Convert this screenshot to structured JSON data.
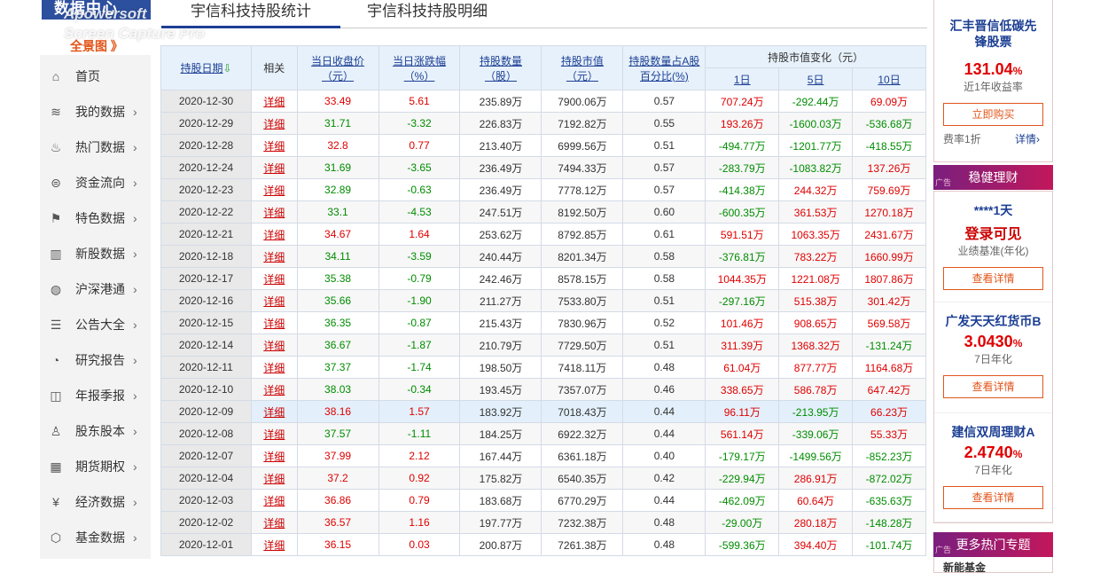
{
  "sidebar": {
    "brand_title": "数据中心",
    "brand_all": "全景图",
    "brand_all_arrow": "》",
    "items": [
      {
        "label": "首页",
        "icon": "⌂",
        "arrow": ""
      },
      {
        "label": "我的数据",
        "icon": "≋",
        "arrow": "›"
      },
      {
        "label": "热门数据",
        "icon": "♨",
        "arrow": "›"
      },
      {
        "label": "资金流向",
        "icon": "⊜",
        "arrow": "›"
      },
      {
        "label": "特色数据",
        "icon": "⚑",
        "arrow": "›"
      },
      {
        "label": "新股数据",
        "icon": "▥",
        "arrow": "›"
      },
      {
        "label": "沪深港通",
        "icon": "◍",
        "arrow": "›"
      },
      {
        "label": "公告大全",
        "icon": "☰",
        "arrow": "›"
      },
      {
        "label": "研究报告",
        "icon": "◔",
        "arrow": "›"
      },
      {
        "label": "年报季报",
        "icon": "◫",
        "arrow": "›"
      },
      {
        "label": "股东股本",
        "icon": "♙",
        "arrow": "›"
      },
      {
        "label": "期货期权",
        "icon": "▦",
        "arrow": "›"
      },
      {
        "label": "经济数据",
        "icon": "¥",
        "arrow": "›"
      },
      {
        "label": "基金数据",
        "icon": "⬡",
        "arrow": "›"
      }
    ]
  },
  "watermark": {
    "line1": "Apowersoft",
    "line2": "Screen Capture Pro"
  },
  "tabs": [
    {
      "label": "宇信科技持股统计"
    },
    {
      "label": "宇信科技持股明细"
    }
  ],
  "table": {
    "headers": {
      "date": "持股日期",
      "date_sort": "⇩",
      "rel": "相关",
      "close": "当日收盘价",
      "close_unit": "（元）",
      "chg": "当日涨跌幅",
      "chg_unit": "（%）",
      "qty": "持股数量",
      "qty_unit": "（股）",
      "mv": "持股市值",
      "mv_unit": "（元）",
      "pct": "持股数量占A股",
      "pct_unit": "百分比(%)",
      "change": "持股市值变化（元）",
      "d1": "1日",
      "d5": "5日",
      "d10": "10日"
    },
    "rows": [
      {
        "date": "2020-12-30",
        "rel": "详细",
        "close": "33.49",
        "chg": "5.61",
        "qty": "235.89万",
        "mv": "7900.06万",
        "pct": "0.57",
        "d1": "707.24万",
        "d5": "-292.44万",
        "d10": "69.09万"
      },
      {
        "date": "2020-12-29",
        "rel": "详细",
        "close": "31.71",
        "chg": "-3.32",
        "qty": "226.83万",
        "mv": "7192.82万",
        "pct": "0.55",
        "d1": "193.26万",
        "d5": "-1600.03万",
        "d10": "-536.68万"
      },
      {
        "date": "2020-12-28",
        "rel": "详细",
        "close": "32.8",
        "chg": "0.77",
        "qty": "213.40万",
        "mv": "6999.56万",
        "pct": "0.51",
        "d1": "-494.77万",
        "d5": "-1201.77万",
        "d10": "-418.55万"
      },
      {
        "date": "2020-12-24",
        "rel": "详细",
        "close": "31.69",
        "chg": "-3.65",
        "qty": "236.49万",
        "mv": "7494.33万",
        "pct": "0.57",
        "d1": "-283.79万",
        "d5": "-1083.82万",
        "d10": "137.26万"
      },
      {
        "date": "2020-12-23",
        "rel": "详细",
        "close": "32.89",
        "chg": "-0.63",
        "qty": "236.49万",
        "mv": "7778.12万",
        "pct": "0.57",
        "d1": "-414.38万",
        "d5": "244.32万",
        "d10": "759.69万"
      },
      {
        "date": "2020-12-22",
        "rel": "详细",
        "close": "33.1",
        "chg": "-4.53",
        "qty": "247.51万",
        "mv": "8192.50万",
        "pct": "0.60",
        "d1": "-600.35万",
        "d5": "361.53万",
        "d10": "1270.18万"
      },
      {
        "date": "2020-12-21",
        "rel": "详细",
        "close": "34.67",
        "chg": "1.64",
        "qty": "253.62万",
        "mv": "8792.85万",
        "pct": "0.61",
        "d1": "591.51万",
        "d5": "1063.35万",
        "d10": "2431.67万"
      },
      {
        "date": "2020-12-18",
        "rel": "详细",
        "close": "34.11",
        "chg": "-3.59",
        "qty": "240.44万",
        "mv": "8201.34万",
        "pct": "0.58",
        "d1": "-376.81万",
        "d5": "783.22万",
        "d10": "1660.99万"
      },
      {
        "date": "2020-12-17",
        "rel": "详细",
        "close": "35.38",
        "chg": "-0.79",
        "qty": "242.46万",
        "mv": "8578.15万",
        "pct": "0.58",
        "d1": "1044.35万",
        "d5": "1221.08万",
        "d10": "1807.86万"
      },
      {
        "date": "2020-12-16",
        "rel": "详细",
        "close": "35.66",
        "chg": "-1.90",
        "qty": "211.27万",
        "mv": "7533.80万",
        "pct": "0.51",
        "d1": "-297.16万",
        "d5": "515.38万",
        "d10": "301.42万"
      },
      {
        "date": "2020-12-15",
        "rel": "详细",
        "close": "36.35",
        "chg": "-0.87",
        "qty": "215.43万",
        "mv": "7830.96万",
        "pct": "0.52",
        "d1": "101.46万",
        "d5": "908.65万",
        "d10": "569.58万"
      },
      {
        "date": "2020-12-14",
        "rel": "详细",
        "close": "36.67",
        "chg": "-1.87",
        "qty": "210.79万",
        "mv": "7729.50万",
        "pct": "0.51",
        "d1": "311.39万",
        "d5": "1368.32万",
        "d10": "-131.24万"
      },
      {
        "date": "2020-12-11",
        "rel": "详细",
        "close": "37.37",
        "chg": "-1.74",
        "qty": "198.50万",
        "mv": "7418.11万",
        "pct": "0.48",
        "d1": "61.04万",
        "d5": "877.77万",
        "d10": "1164.68万"
      },
      {
        "date": "2020-12-10",
        "rel": "详细",
        "close": "38.03",
        "chg": "-0.34",
        "qty": "193.45万",
        "mv": "7357.07万",
        "pct": "0.46",
        "d1": "338.65万",
        "d5": "586.78万",
        "d10": "647.42万"
      },
      {
        "date": "2020-12-09",
        "rel": "详细",
        "close": "38.16",
        "chg": "1.57",
        "qty": "183.92万",
        "mv": "7018.43万",
        "pct": "0.44",
        "d1": "96.11万",
        "d5": "-213.95万",
        "d10": "66.23万"
      },
      {
        "date": "2020-12-08",
        "rel": "详细",
        "close": "37.57",
        "chg": "-1.11",
        "qty": "184.25万",
        "mv": "6922.32万",
        "pct": "0.44",
        "d1": "561.14万",
        "d5": "-339.06万",
        "d10": "55.33万"
      },
      {
        "date": "2020-12-07",
        "rel": "详细",
        "close": "37.99",
        "chg": "2.12",
        "qty": "167.44万",
        "mv": "6361.18万",
        "pct": "0.40",
        "d1": "-179.17万",
        "d5": "-1499.56万",
        "d10": "-852.23万"
      },
      {
        "date": "2020-12-04",
        "rel": "详细",
        "close": "37.2",
        "chg": "0.92",
        "qty": "175.82万",
        "mv": "6540.35万",
        "pct": "0.42",
        "d1": "-229.94万",
        "d5": "286.91万",
        "d10": "-872.02万"
      },
      {
        "date": "2020-12-03",
        "rel": "详细",
        "close": "36.86",
        "chg": "0.79",
        "qty": "183.68万",
        "mv": "6770.29万",
        "pct": "0.44",
        "d1": "-462.09万",
        "d5": "60.64万",
        "d10": "-635.63万"
      },
      {
        "date": "2020-12-02",
        "rel": "详细",
        "close": "36.57",
        "chg": "1.16",
        "qty": "197.77万",
        "mv": "7232.38万",
        "pct": "0.48",
        "d1": "-29.00万",
        "d5": "280.18万",
        "d10": "-148.28万"
      },
      {
        "date": "2020-12-01",
        "rel": "详细",
        "close": "36.15",
        "chg": "0.03",
        "qty": "200.87万",
        "mv": "7261.38万",
        "pct": "0.48",
        "d1": "-599.36万",
        "d5": "394.40万",
        "d10": "-101.74万"
      }
    ]
  },
  "ad": {
    "p1": {
      "name": "汇丰晋信低碳先锋股票",
      "rate": "131.04",
      "rate_unit": "%",
      "desc": "近1年收益率",
      "btn": "立即购买",
      "fee_label": "费率1折",
      "detail": "详情",
      "detail_arrow": "›"
    },
    "p2": {
      "header": "稳健理财",
      "ad_tag": "广告",
      "items": [
        {
          "name": "****1天",
          "rate": "登录可见",
          "rate_unit": "",
          "desc": "业绩基准(年化)",
          "btn": "查看详情"
        },
        {
          "name": "广发天天红货币B",
          "rate": "3.0430",
          "rate_unit": "%",
          "desc": "7日年化",
          "btn": "查看详情"
        },
        {
          "name": "建信双周理财A",
          "rate": "2.4740",
          "rate_unit": "%",
          "desc": "7日年化",
          "btn": "查看详情"
        }
      ]
    },
    "p3": {
      "header": "更多热门专题",
      "ad_tag": "广告",
      "first_item": "新能基金"
    }
  },
  "colors": {
    "up": "#e00000",
    "down": "#008c00",
    "link": "#1c3f94",
    "accent": "#e2561b"
  }
}
